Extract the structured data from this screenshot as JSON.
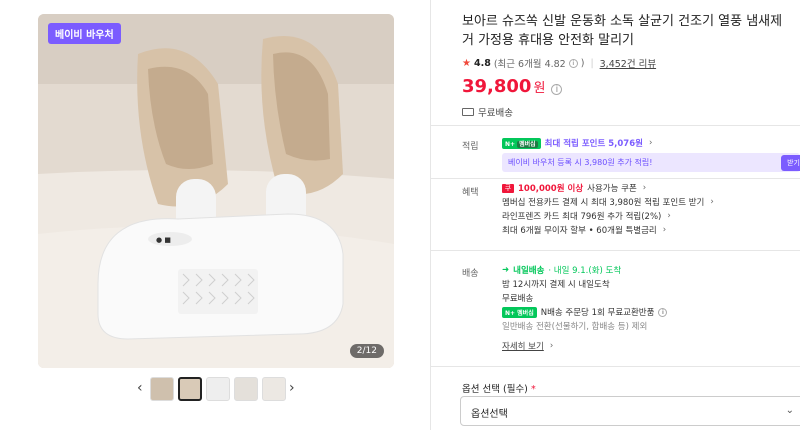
{
  "gallery": {
    "badge": "베이비 바우처",
    "counter": "2/12",
    "prev_icon": "‹",
    "next_icon": "›",
    "thumbnails": [
      "thumb-1",
      "thumb-2",
      "thumb-3",
      "thumb-4",
      "thumb-5"
    ],
    "active_thumbnail": 2
  },
  "product": {
    "title": "보아르 슈즈쏙 신발 운동화 소독 살균기 건조기 열풍 냄새제거 가정용 휴대용 안전화 말리기",
    "rating": "4.8",
    "rating_note": "(최근 6개월 4.82",
    "rating_note_close": ")",
    "reviews": "3,452건 리뷰",
    "price": "39,800",
    "price_unit": "원",
    "free_shipping": "무료배송"
  },
  "points": {
    "label": "적립",
    "npay_badge": "N+",
    "npay_sub": "멤버십",
    "max_points": "최대 적립 포인트 5,076원",
    "voucher_text": "베이비 바우처 등록 시 3,980원 추가 적립!",
    "voucher_button": "받기"
  },
  "benefits": {
    "label": "혜택",
    "coupon_icon": "쿠",
    "coupon_strong": "100,000원 이상",
    "coupon_rest": "사용가능 쿠폰",
    "line2": "멤버십 전용카드 결제 시 최대 3,980원 적립 포인트 받기",
    "line3": "라인프렌즈 카드 최대 796원 추가 적립(2%)",
    "line4": "최대 6개월 무이자 할부 • 60개월 특별금리"
  },
  "delivery": {
    "label": "배송",
    "tomorrow": "내일배송",
    "date": "· 내일 9.1.(화) 도착",
    "cutoff": "밤 12시까지 결제 시 내일도착",
    "free": "무료배송",
    "ndel_badge": "N+",
    "ndel_sub": "멤버십",
    "return_text": "N배송 주문당 1회 무료교환반품",
    "exclusion": "일반배송 전환(선물하기, 합배송 등) 제외",
    "detail_link": "자세히 보기"
  },
  "option": {
    "label": "옵션 선택 (필수)",
    "required_mark": "*",
    "placeholder": "옵션선택"
  },
  "colors": {
    "price_red": "#f0163a",
    "npay_green": "#03c75a",
    "voucher_purple": "#7b5cff"
  }
}
